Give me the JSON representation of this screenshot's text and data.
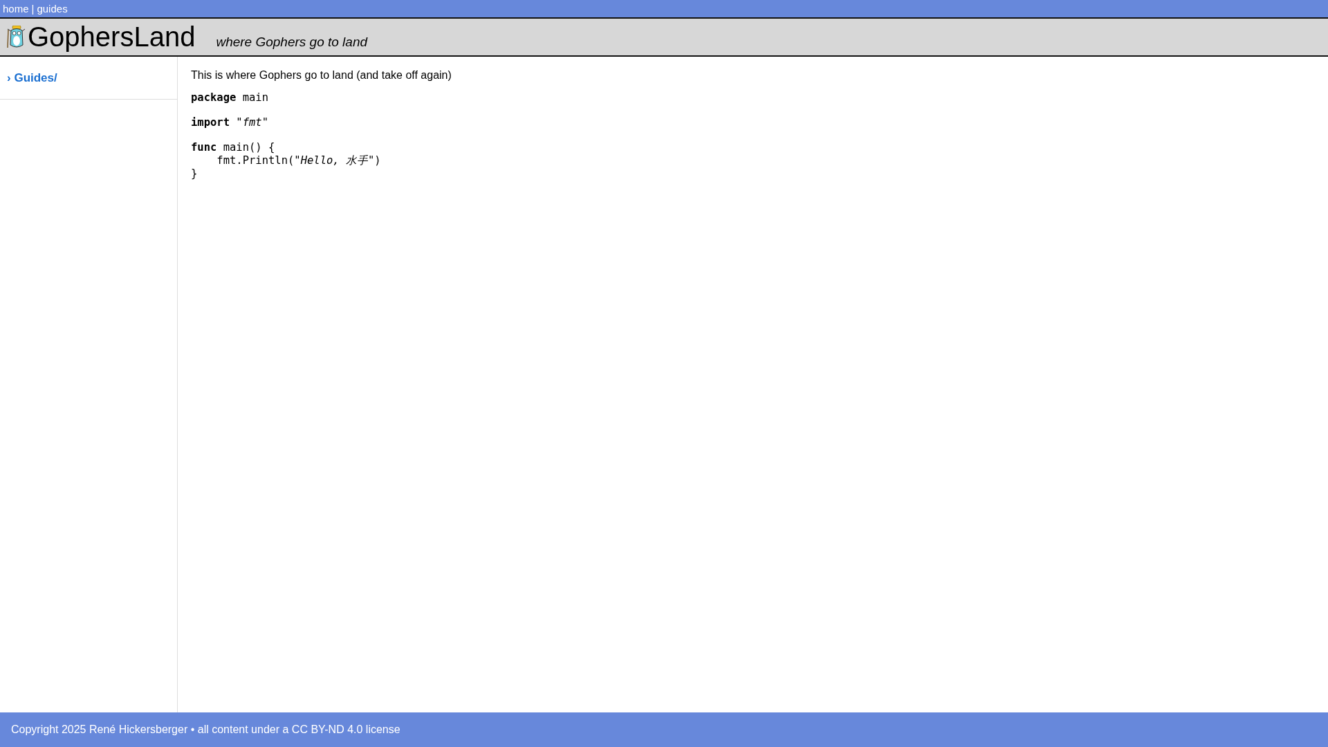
{
  "top_nav": {
    "links": [
      "home",
      "guides"
    ],
    "separator": "|"
  },
  "header": {
    "title": "GophersLand",
    "tagline": "where Gophers go to land"
  },
  "sidebar": {
    "items": [
      {
        "marker": "›",
        "label": "Guides/"
      }
    ]
  },
  "content": {
    "intro": "This is where Gophers go to land (and take off again)",
    "code_blocks": [
      [
        "**package** main"
      ],
      [
        "**import** \"*fmt*\""
      ],
      [
        "**func** main() {",
        "    fmt.Println(\"*Hello, 水手*\")",
        "}"
      ]
    ]
  },
  "footer": {
    "text": "Copyright 2025 René Hickersberger • all content under a CC BY-ND 4.0 license"
  }
}
